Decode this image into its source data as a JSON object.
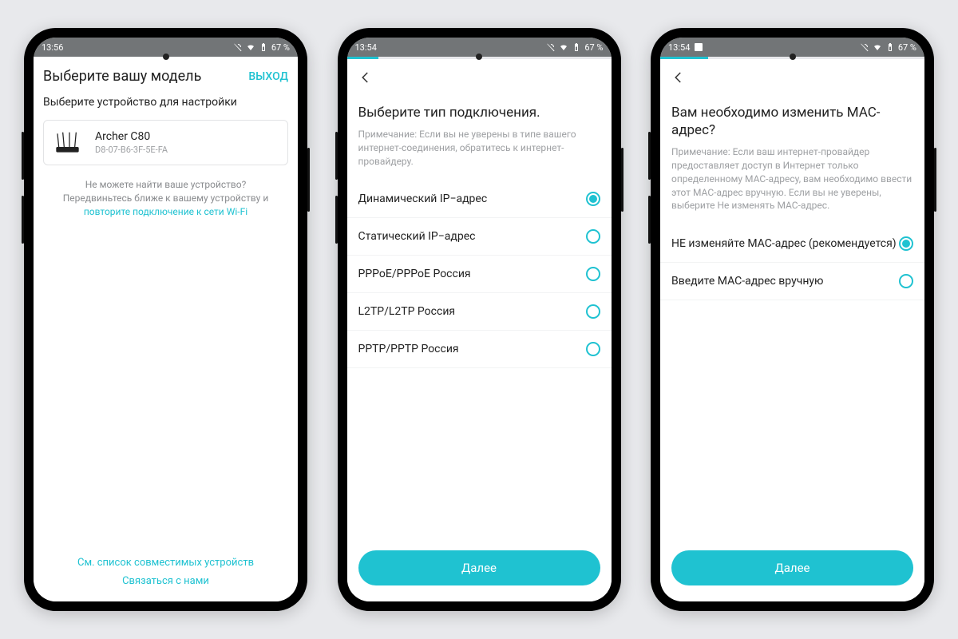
{
  "colors": {
    "accent": "#1fc2d1",
    "muted": "#9ea0a3"
  },
  "phone1": {
    "status": {
      "time": "13:56",
      "battery": "67 %"
    },
    "title": "Выберите вашу модель",
    "exit": "ВЫХОД",
    "subtitle": "Выберите устройство для настройки",
    "device": {
      "name": "Archer C80",
      "mac": "D8-07-B6-3F-5E-FA"
    },
    "help_prefix": "Не можете найти ваше устройство? Передвиньтесь ближе к вашему устройству и ",
    "help_link": "повторите подключение к сети Wi-Fi",
    "link_compatible": "См. список совместимых устройств",
    "link_contact": "Связаться с нами"
  },
  "phone2": {
    "status": {
      "time": "13:54",
      "battery": "67 %"
    },
    "progress_percent": 12,
    "title": "Выберите тип подключения.",
    "note": "Примечание: Если вы не уверены в типе вашего интернет-соединения, обратитесь к интернет-провайдеру.",
    "options": [
      {
        "label": "Динамический IP−адрес",
        "selected": true
      },
      {
        "label": "Статический IP−адрес",
        "selected": false
      },
      {
        "label": "PPPoE/PPPoE Россия",
        "selected": false
      },
      {
        "label": "L2TP/L2TP Россия",
        "selected": false
      },
      {
        "label": "PPTP/PPTP Россия",
        "selected": false
      }
    ],
    "next": "Далее"
  },
  "phone3": {
    "status": {
      "time": "13:54",
      "battery": "67 %"
    },
    "progress_percent": 18,
    "title": "Вам необходимо изменить MAC-адрес?",
    "note": "Примечание: Если ваш интернет-провайдер предоставляет доступ в Интернет только определенному MAC-адресу, вам необходимо ввести этот MAC-адрес вручную. Если вы не уверены, выберите Не изменять MAC-адрес.",
    "options": [
      {
        "label": "НЕ изменяйте MAC-адрес (рекомендуется)",
        "selected": true
      },
      {
        "label": "Введите MAC-адрес вручную",
        "selected": false
      }
    ],
    "next": "Далее"
  }
}
